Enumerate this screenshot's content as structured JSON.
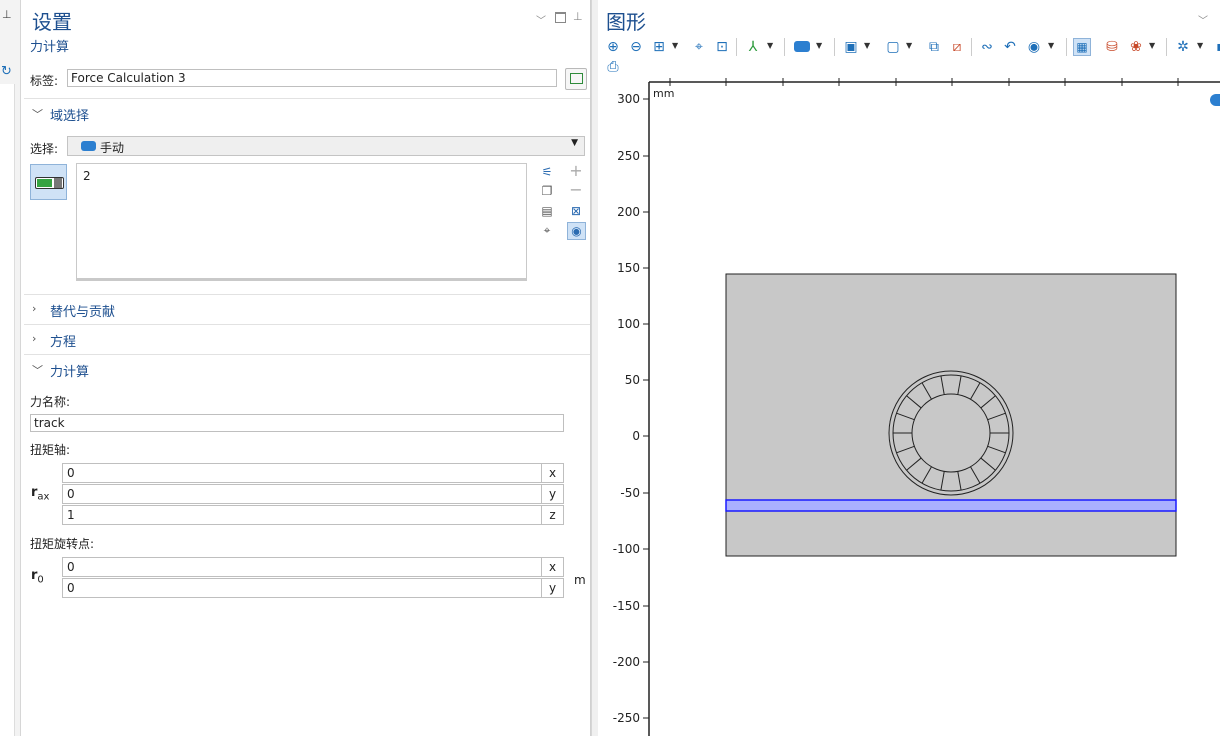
{
  "settings": {
    "title": "设置",
    "subtitle": "力计算",
    "label_caption": "标签:",
    "label_value": "Force Calculation 3",
    "domain_section": "域选择",
    "selection_caption": "选择:",
    "selection_value": "手动",
    "selection_entries": [
      "2"
    ],
    "collapsed_sections": [
      "替代与贡献",
      "方程"
    ],
    "force_section": "力计算",
    "force_name_caption": "力名称:",
    "force_name_value": "track",
    "torque_axis_caption": "扭矩轴:",
    "r_ax_symbol": "r",
    "r_ax_sub": "ax",
    "r_ax": [
      {
        "value": "0",
        "unit": "x"
      },
      {
        "value": "0",
        "unit": "y"
      },
      {
        "value": "1",
        "unit": "z"
      }
    ],
    "torque_point_caption": "扭矩旋转点:",
    "r0_symbol": "r",
    "r0_sub": "0",
    "r0": [
      {
        "value": "0",
        "unit": "x"
      },
      {
        "value": "0",
        "unit": "y"
      }
    ],
    "r0_unit": "m"
  },
  "graphics": {
    "title": "图形",
    "unit_label": "mm",
    "y_ticks": [
      "300",
      "250",
      "200",
      "150",
      "100",
      "50",
      "0",
      "-50",
      "-100",
      "-150",
      "-200",
      "-250"
    ],
    "colors": {
      "domain_fill": "#c8c8c8",
      "highlight": "#1a1aff",
      "highlight_fill": "#aab0ff",
      "accent": "#1d4f8f"
    }
  }
}
